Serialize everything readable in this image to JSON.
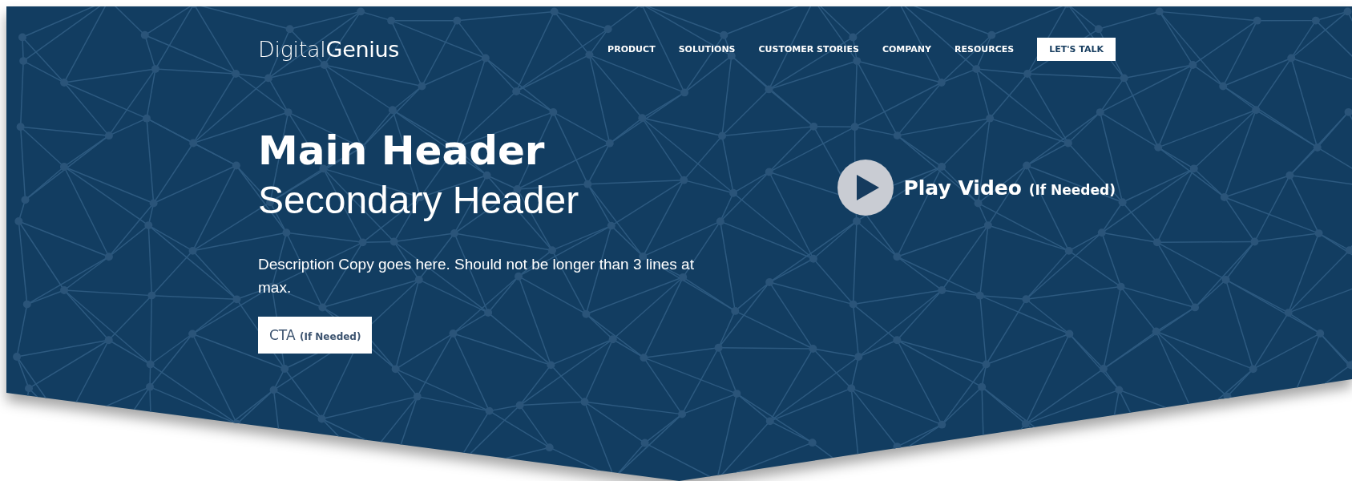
{
  "logo": "Digital**Genius**",
  "nav": [
    {
      "label": "PRODUCT",
      "kind": "link"
    },
    {
      "label": "SOLUTIONS",
      "kind": "link"
    },
    {
      "label": "CUSTOMER STORIES",
      "kind": "link"
    },
    {
      "label": "COMPANY",
      "kind": "link"
    },
    {
      "label": "RESOURCES",
      "kind": "link"
    },
    {
      "label": "LET'S TALK",
      "kind": "button"
    }
  ],
  "hero": {
    "main_header": "Main Header",
    "secondary_header": "Secondary Header",
    "description": "Description Copy goes here. Should not be longer than 3 lines at max.",
    "cta": {
      "label": "CTA",
      "note": "(If Needed)"
    },
    "play_video": {
      "label": "Play Video",
      "note": "(If Needed)"
    }
  }
}
